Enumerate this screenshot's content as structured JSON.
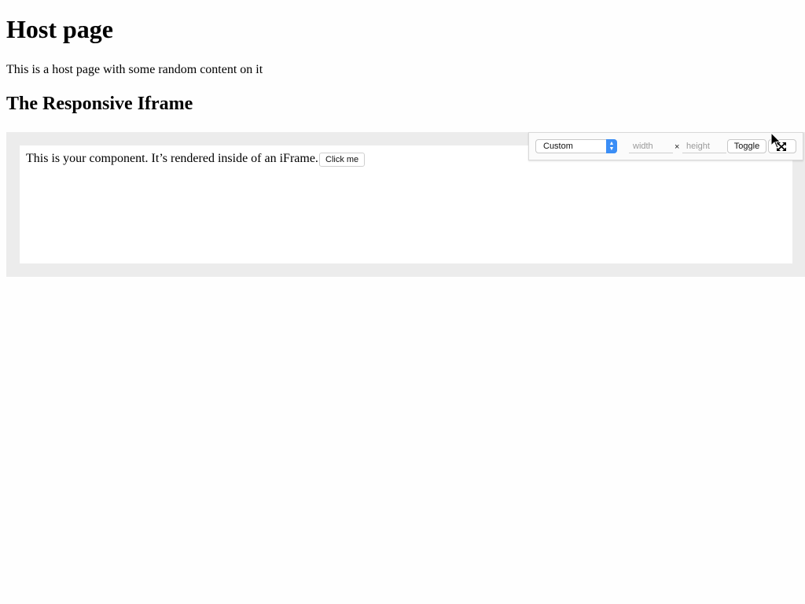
{
  "page": {
    "title": "Host page",
    "intro": "This is a host page with some random content on it",
    "section_heading": "The Responsive Iframe"
  },
  "iframe": {
    "component_text": "This is your component. It’s rendered inside of an iFrame.",
    "button_label": "Click me"
  },
  "toolbar": {
    "preset_value": "Custom",
    "width_placeholder": "width",
    "height_placeholder": "height",
    "separator": "×",
    "toggle_label": "Toggle",
    "fullscreen_icon": "expand-icon",
    "select_accent": "#3b8ef6"
  },
  "colors": {
    "frame_background": "#ececec",
    "page_background": "#fefefe"
  }
}
